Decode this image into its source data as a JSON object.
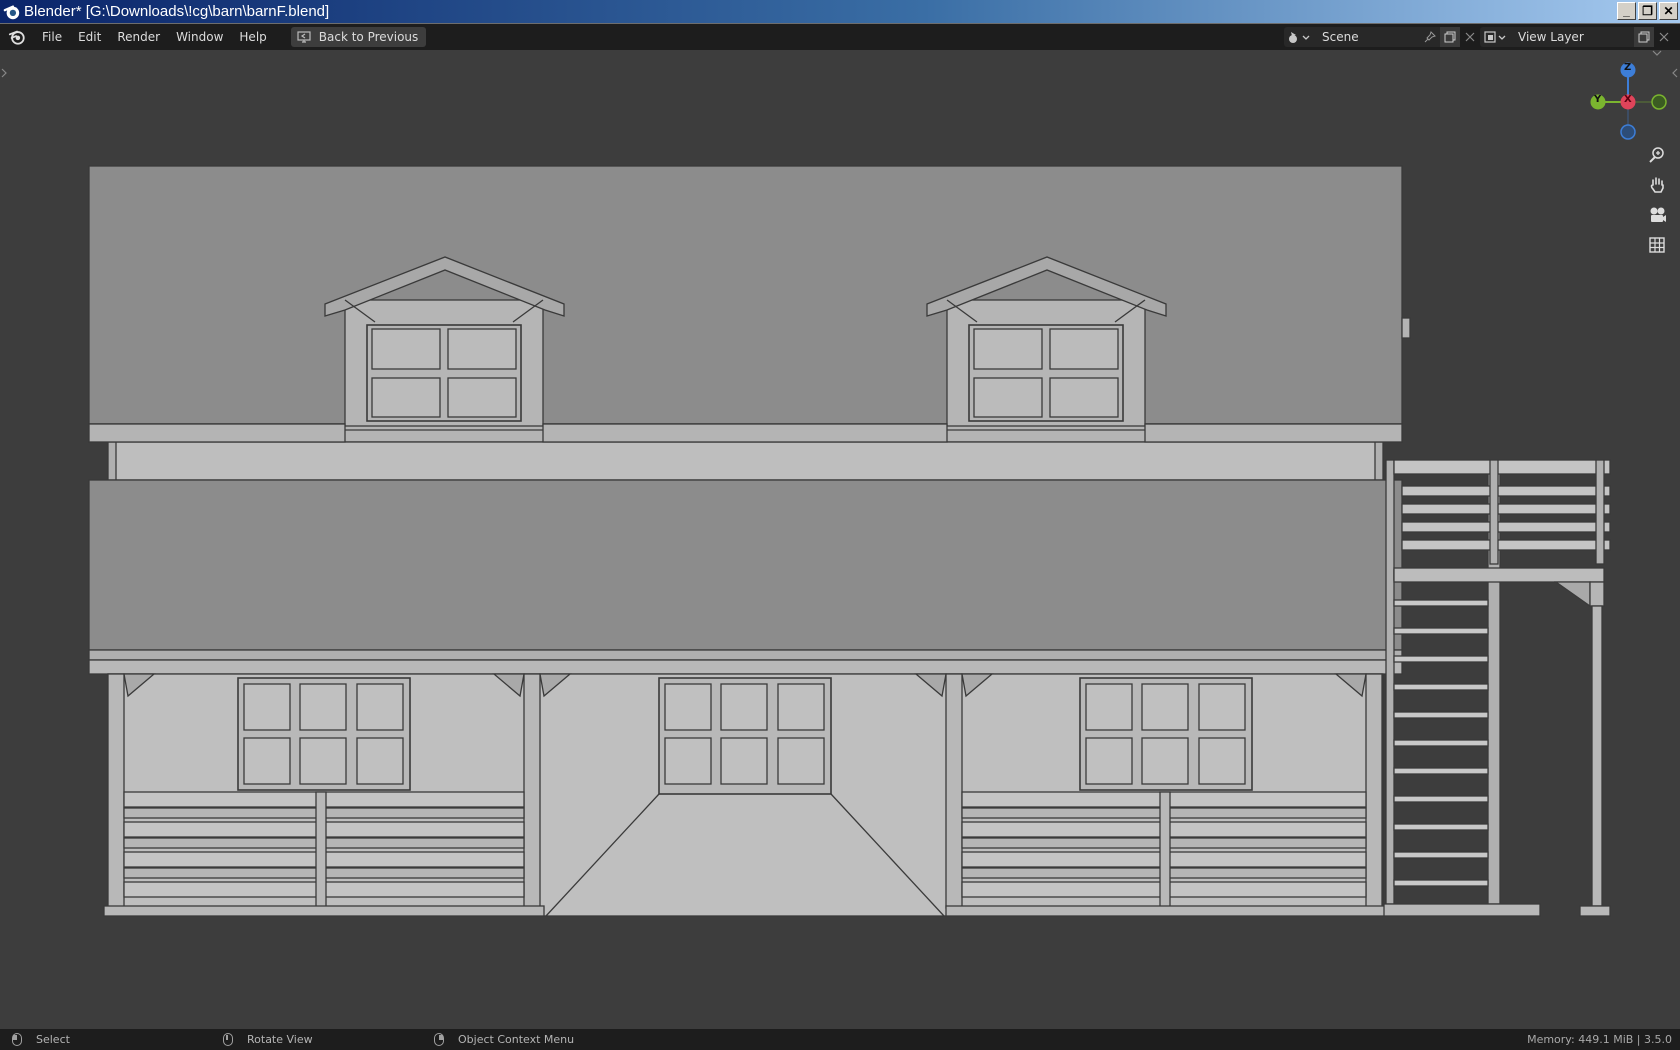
{
  "window": {
    "title": "Blender* [G:\\Downloads\\!cg\\barn\\barnF.blend]",
    "minimize": "_",
    "restore": "❐",
    "close": "✕"
  },
  "menu": {
    "items": [
      "File",
      "Edit",
      "Render",
      "Window",
      "Help"
    ],
    "back_button": "Back to Previous"
  },
  "scene": {
    "label": "Scene"
  },
  "view_layer": {
    "label": "View Layer"
  },
  "gizmo": {
    "z": "Z",
    "y": "Y",
    "x": "X"
  },
  "status": {
    "select": "Select",
    "rotate": "Rotate View",
    "context": "Object Context Menu",
    "memory": "Memory: 449.1 MiB | 3.5.0"
  },
  "colors": {
    "viewport_bg": "#3d3d3d",
    "header_bg": "#1d1d1d",
    "axis_x": "#e0445a",
    "axis_y": "#7bb52f",
    "axis_z": "#3d7ed8"
  }
}
